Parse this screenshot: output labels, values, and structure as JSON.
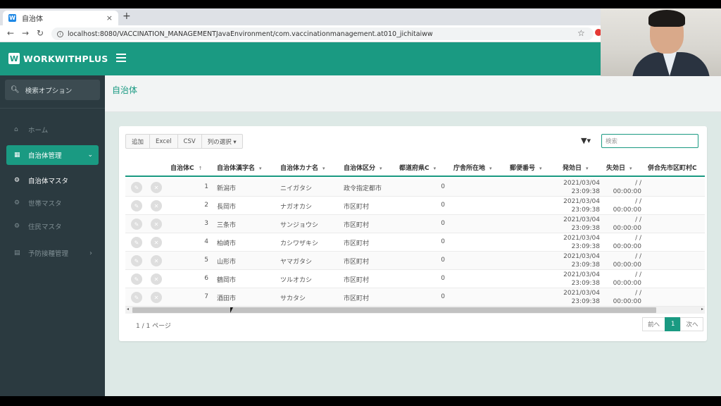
{
  "browser": {
    "tab_title": "自治体",
    "favicon_text": "W",
    "new_tab": "+",
    "close": "×",
    "url": "localhost:8080/VACCINATION_MANAGEMENTJavaEnvironment/com.vaccinationmanagement.at010_jichitaiww"
  },
  "app": {
    "logo_mark": "W",
    "logo_text": "WORKWITHPLUS"
  },
  "sidebar": {
    "search_option": "検索オプション",
    "items": [
      {
        "label": "ホーム",
        "icon": "home-icon"
      },
      {
        "label": "自治体管理",
        "icon": "calendar-icon"
      },
      {
        "label": "自治体マスタ",
        "icon": "gear-icon"
      },
      {
        "label": "世帯マスタ",
        "icon": "gear-icon"
      },
      {
        "label": "住民マスタ",
        "icon": "gear-icon"
      },
      {
        "label": "予防接種管理",
        "icon": "clipboard-icon"
      }
    ]
  },
  "page": {
    "title": "自治体"
  },
  "toolbar": {
    "add": "追加",
    "excel": "Excel",
    "csv": "CSV",
    "columns": "列の選択 ▾",
    "search_placeholder": "検索"
  },
  "table": {
    "columns": [
      {
        "label": "自治体C",
        "sort": "↑"
      },
      {
        "label": "自治体漢字名",
        "sort": "▾"
      },
      {
        "label": "自治体カナ名",
        "sort": "▾"
      },
      {
        "label": "自治体区分",
        "sort": "▾"
      },
      {
        "label": "都道府県C",
        "sort": "▾"
      },
      {
        "label": "庁舎所在地",
        "sort": "▾"
      },
      {
        "label": "郵便番号",
        "sort": "▾"
      },
      {
        "label": "発効日",
        "sort": "▾"
      },
      {
        "label": "失効日",
        "sort": "▾"
      },
      {
        "label": "併合先市区町村C",
        "sort": ""
      }
    ],
    "rows": [
      {
        "code": "1",
        "kanji": "新潟市",
        "kana": "ニイガタシ",
        "kubun": "政令指定都市",
        "pref": "0",
        "eff_date": "2021/03/04",
        "eff_time": "23:09:38",
        "exp_date": "/ /",
        "exp_time": "00:00:00"
      },
      {
        "code": "2",
        "kanji": "長岡市",
        "kana": "ナガオカシ",
        "kubun": "市区町村",
        "pref": "0",
        "eff_date": "2021/03/04",
        "eff_time": "23:09:38",
        "exp_date": "/ /",
        "exp_time": "00:00:00"
      },
      {
        "code": "3",
        "kanji": "三条市",
        "kana": "サンジョウシ",
        "kubun": "市区町村",
        "pref": "0",
        "eff_date": "2021/03/04",
        "eff_time": "23:09:38",
        "exp_date": "/ /",
        "exp_time": "00:00:00"
      },
      {
        "code": "4",
        "kanji": "柏崎市",
        "kana": "カシワザキシ",
        "kubun": "市区町村",
        "pref": "0",
        "eff_date": "2021/03/04",
        "eff_time": "23:09:38",
        "exp_date": "/ /",
        "exp_time": "00:00:00"
      },
      {
        "code": "5",
        "kanji": "山形市",
        "kana": "ヤマガタシ",
        "kubun": "市区町村",
        "pref": "0",
        "eff_date": "2021/03/04",
        "eff_time": "23:09:38",
        "exp_date": "/ /",
        "exp_time": "00:00:00"
      },
      {
        "code": "6",
        "kanji": "鶴岡市",
        "kana": "ツルオカシ",
        "kubun": "市区町村",
        "pref": "0",
        "eff_date": "2021/03/04",
        "eff_time": "23:09:38",
        "exp_date": "/ /",
        "exp_time": "00:00:00"
      },
      {
        "code": "7",
        "kanji": "酒田市",
        "kana": "サカタシ",
        "kubun": "市区町村",
        "pref": "0",
        "eff_date": "2021/03/04",
        "eff_time": "23:09:38",
        "exp_date": "/ /",
        "exp_time": "00:00:00"
      }
    ]
  },
  "pagination": {
    "info": "1 / 1 ページ",
    "prev": "前へ",
    "current": "1",
    "next": "次へ"
  },
  "colors": {
    "accent": "#1a9a82",
    "sidebar_bg": "#2b3a40",
    "page_bg": "#dde9e6"
  }
}
